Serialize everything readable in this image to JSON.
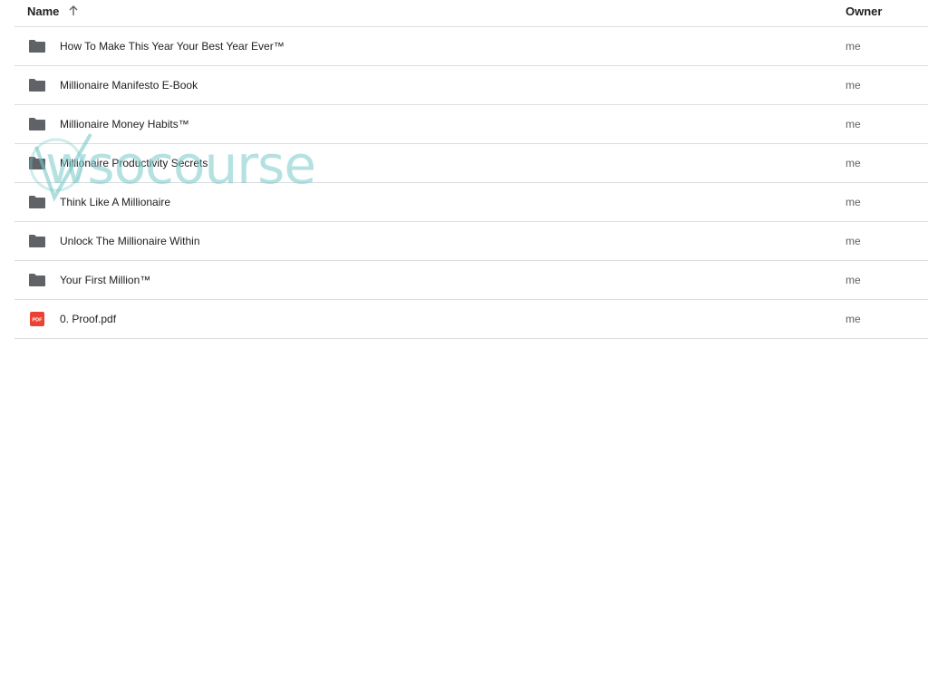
{
  "header": {
    "name_label": "Name",
    "owner_label": "Owner",
    "sort_icon": "arrow-up-icon"
  },
  "files": [
    {
      "name": "How To Make This Year Your Best Year Ever™",
      "owner": "me",
      "type": "folder",
      "icon": "folder-icon"
    },
    {
      "name": "Millionaire Manifesto E-Book",
      "owner": "me",
      "type": "folder",
      "icon": "folder-icon"
    },
    {
      "name": "Millionaire Money Habits™",
      "owner": "me",
      "type": "folder",
      "icon": "folder-icon"
    },
    {
      "name": "Millionaire Productivity Secrets",
      "owner": "me",
      "type": "folder",
      "icon": "folder-icon"
    },
    {
      "name": "Think Like A Millionaire",
      "owner": "me",
      "type": "folder",
      "icon": "folder-icon"
    },
    {
      "name": "Unlock The Millionaire Within",
      "owner": "me",
      "type": "folder",
      "icon": "folder-icon"
    },
    {
      "name": "Your First Million™",
      "owner": "me",
      "type": "folder",
      "icon": "folder-icon"
    },
    {
      "name": "0. Proof.pdf",
      "owner": "me",
      "type": "pdf",
      "icon": "pdf-icon",
      "icon_label": "PDF"
    }
  ],
  "watermark": {
    "text": "wsocourse"
  },
  "colors": {
    "folder": "#5f6368",
    "pdf": "#ea4335",
    "divider": "#dadce0",
    "watermark": "#78c8c8"
  }
}
